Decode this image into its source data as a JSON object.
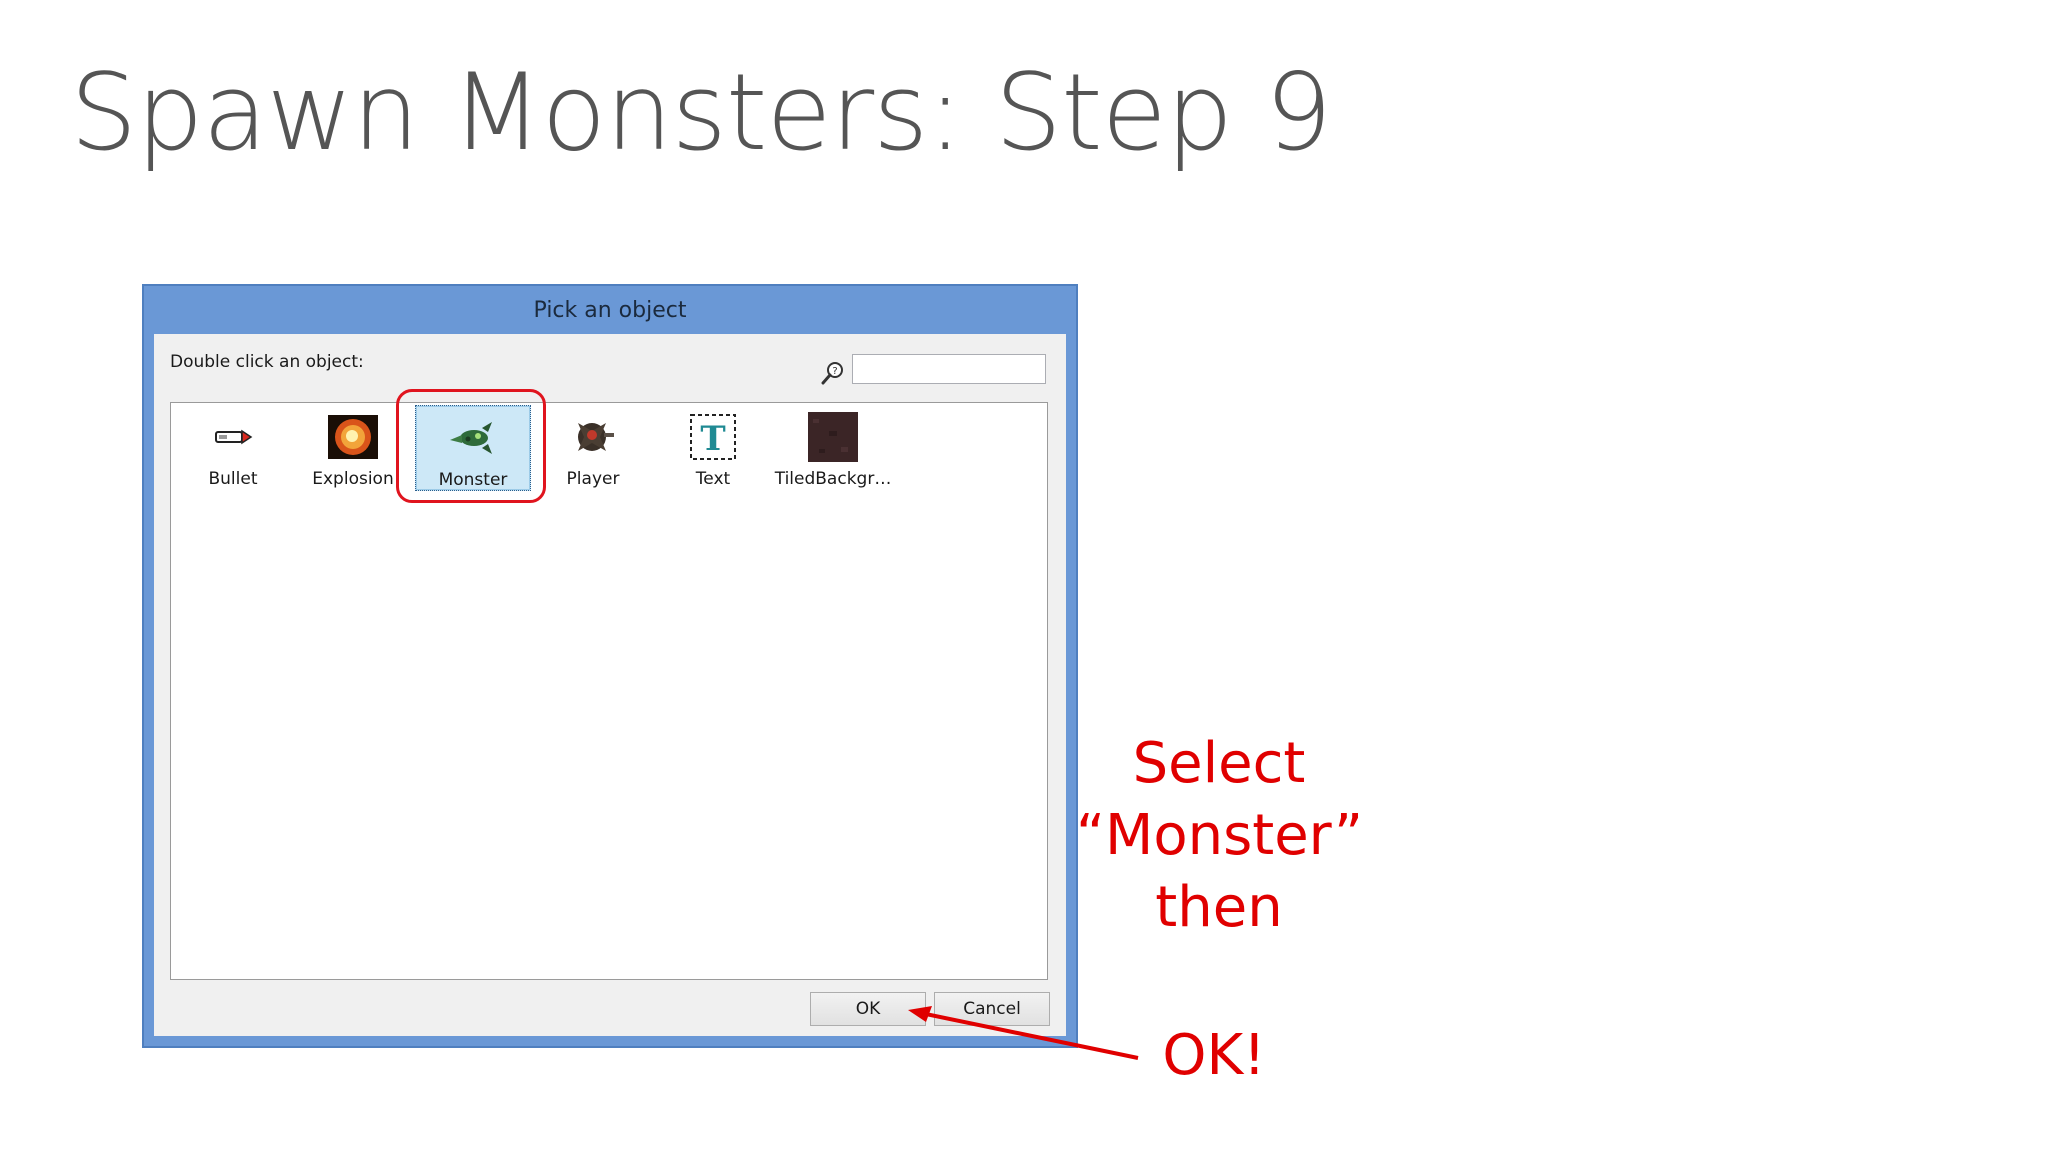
{
  "slide": {
    "title": "Spawn Monsters: Step 9"
  },
  "dialog": {
    "title": "Pick an object",
    "prompt": "Double click an object:",
    "search": {
      "value": "",
      "placeholder": ""
    },
    "objects": [
      {
        "label": "Bullet",
        "icon": "bullet-icon",
        "selected": false
      },
      {
        "label": "Explosion",
        "icon": "explosion-icon",
        "selected": false
      },
      {
        "label": "Monster",
        "icon": "monster-icon",
        "selected": true
      },
      {
        "label": "Player",
        "icon": "player-icon",
        "selected": false
      },
      {
        "label": "Text",
        "icon": "text-icon",
        "selected": false
      },
      {
        "label": "TiledBackgr…",
        "icon": "tiled-background-icon",
        "selected": false
      }
    ],
    "ok_label": "OK",
    "cancel_label": "Cancel"
  },
  "annotations": {
    "instruction_line1": "Select",
    "instruction_line2": "“Monster”",
    "instruction_line3": "then",
    "ok_callout": "OK!",
    "color": "#e00000"
  }
}
